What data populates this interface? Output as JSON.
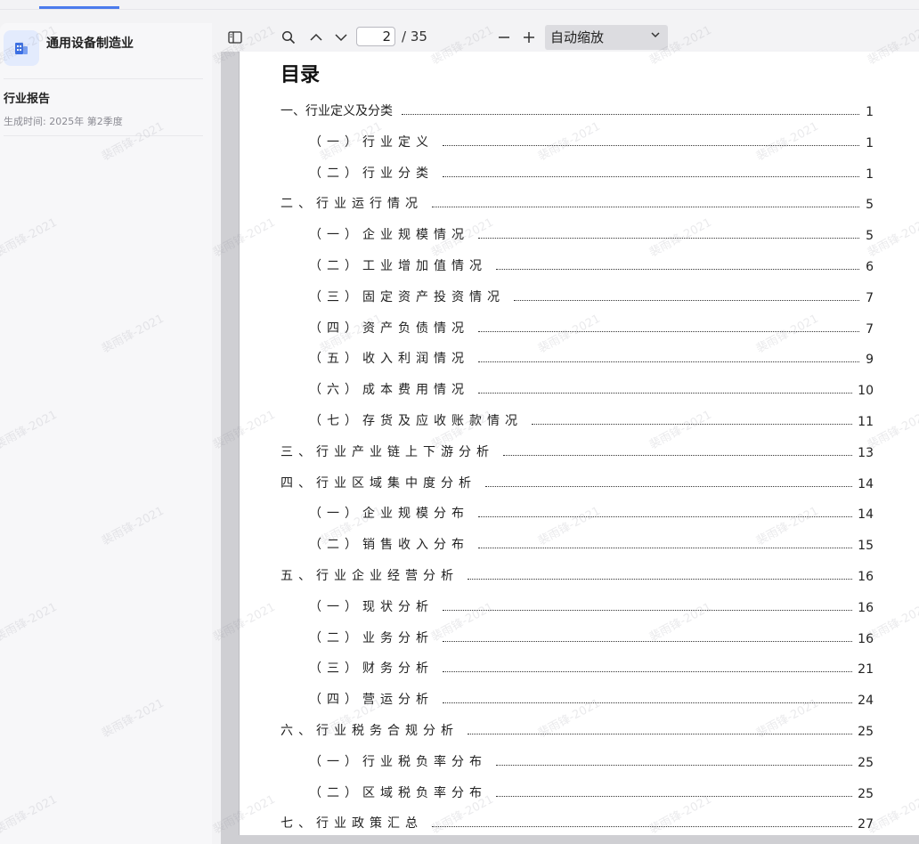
{
  "sidebar": {
    "app_title": "通用设备制造业",
    "report_title": "行业报告",
    "report_time": "生成时间: 2025年 第2季度"
  },
  "toolbar": {
    "current_page": "2",
    "total_pages": "/ 35",
    "zoom_value": "自动缩放"
  },
  "toc": {
    "heading": "目录",
    "entries": [
      {
        "label": "一、行业定义及分类",
        "page": "1",
        "level": 1
      },
      {
        "label": "（一）行业定义",
        "page": "1",
        "level": 2
      },
      {
        "label": "（二）行业分类",
        "page": "1",
        "level": 2
      },
      {
        "label": "二、行业运行情况",
        "page": "5",
        "level": 1
      },
      {
        "label": "（一）企业规模情况",
        "page": "5",
        "level": 2
      },
      {
        "label": "（二）工业增加值情况",
        "page": "6",
        "level": 2
      },
      {
        "label": "（三）固定资产投资情况",
        "page": "7",
        "level": 2
      },
      {
        "label": "（四）资产负债情况",
        "page": "7",
        "level": 2
      },
      {
        "label": "（五）收入利润情况",
        "page": "9",
        "level": 2
      },
      {
        "label": "（六）成本费用情况",
        "page": "10",
        "level": 2
      },
      {
        "label": "（七）存货及应收账款情况",
        "page": "11",
        "level": 2
      },
      {
        "label": "三、行业产业链上下游分析",
        "page": "13",
        "level": 1
      },
      {
        "label": "四、行业区域集中度分析",
        "page": "14",
        "level": 1
      },
      {
        "label": "（一）企业规模分布",
        "page": "14",
        "level": 2
      },
      {
        "label": "（二）销售收入分布",
        "page": "15",
        "level": 2
      },
      {
        "label": "五、行业企业经营分析",
        "page": "16",
        "level": 1
      },
      {
        "label": "（一）现状分析",
        "page": "16",
        "level": 2
      },
      {
        "label": "（二）业务分析",
        "page": "16",
        "level": 2
      },
      {
        "label": "（三）财务分析",
        "page": "21",
        "level": 2
      },
      {
        "label": "（四）营运分析",
        "page": "24",
        "level": 2
      },
      {
        "label": "六、行业税务合规分析",
        "page": "25",
        "level": 1
      },
      {
        "label": "（一）行业税负率分布",
        "page": "25",
        "level": 2
      },
      {
        "label": "（二）区域税负率分布",
        "page": "25",
        "level": 2
      },
      {
        "label": "七、行业政策汇总",
        "page": "27",
        "level": 1
      }
    ]
  },
  "watermark_text": "裴雨锋-2021"
}
